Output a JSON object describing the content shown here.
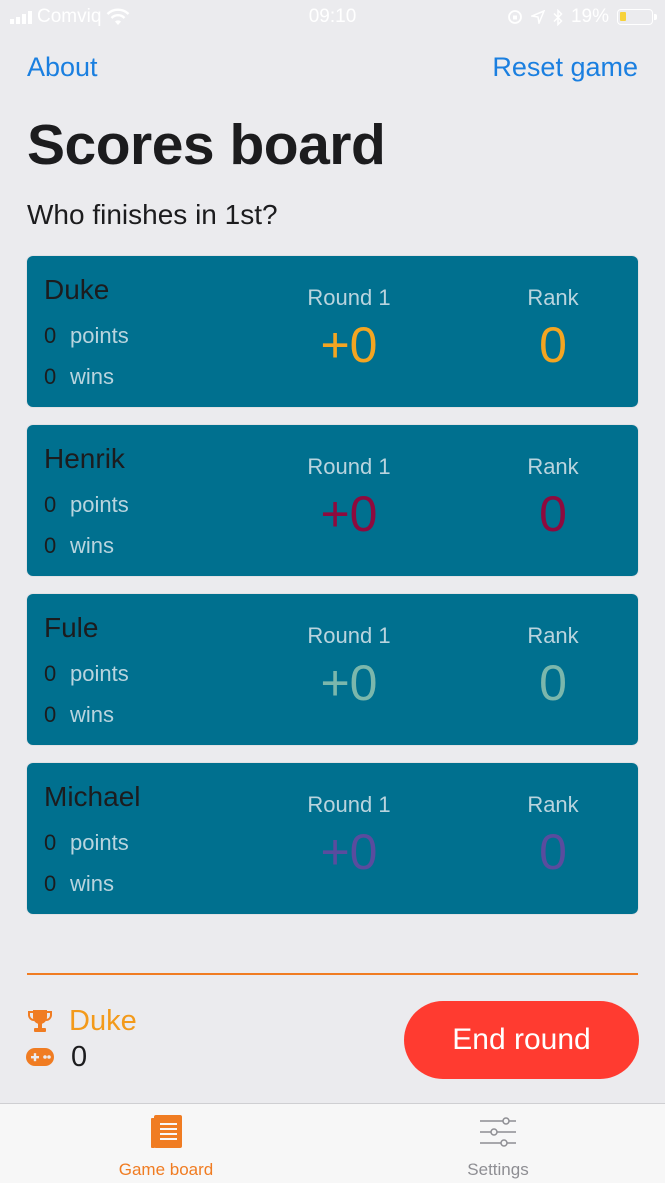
{
  "status_bar": {
    "carrier": "Comviq",
    "time": "09:10",
    "battery": "19%",
    "battery_level": 0.19,
    "battery_color": "#f7d23a"
  },
  "nav": {
    "about_label": "About",
    "reset_label": "Reset game"
  },
  "page": {
    "title": "Scores board",
    "subtitle": "Who finishes in 1st?"
  },
  "players": [
    {
      "name": "Duke",
      "points": "0",
      "wins": "0",
      "round_label": "Round 1",
      "round_score": "+0",
      "rank_label": "Rank",
      "rank": "0",
      "color": "#f4a521"
    },
    {
      "name": "Henrik",
      "points": "0",
      "wins": "0",
      "round_label": "Round 1",
      "round_score": "+0",
      "rank_label": "Rank",
      "rank": "0",
      "color": "#8e0a3e"
    },
    {
      "name": "Fule",
      "points": "0",
      "wins": "0",
      "round_label": "Round 1",
      "round_score": "+0",
      "rank_label": "Rank",
      "rank": "0",
      "color": "#7bb7ac"
    },
    {
      "name": "Michael",
      "points": "0",
      "wins": "0",
      "round_label": "Round 1",
      "round_score": "+0",
      "rank_label": "Rank",
      "rank": "0",
      "color": "#5a4c9e"
    }
  ],
  "labels": {
    "points": "points",
    "wins": "wins"
  },
  "footer": {
    "leader_name": "Duke",
    "rounds_played": "0",
    "end_round_label": "End round"
  },
  "tab_bar": {
    "game_board_label": "Game board",
    "settings_label": "Settings",
    "active_color": "#f07c22",
    "inactive_color": "#8e8e93"
  },
  "colors": {
    "accent": "#f07c22",
    "link": "#1a7fe0",
    "card": "#00708f",
    "danger": "#ff3b30"
  }
}
